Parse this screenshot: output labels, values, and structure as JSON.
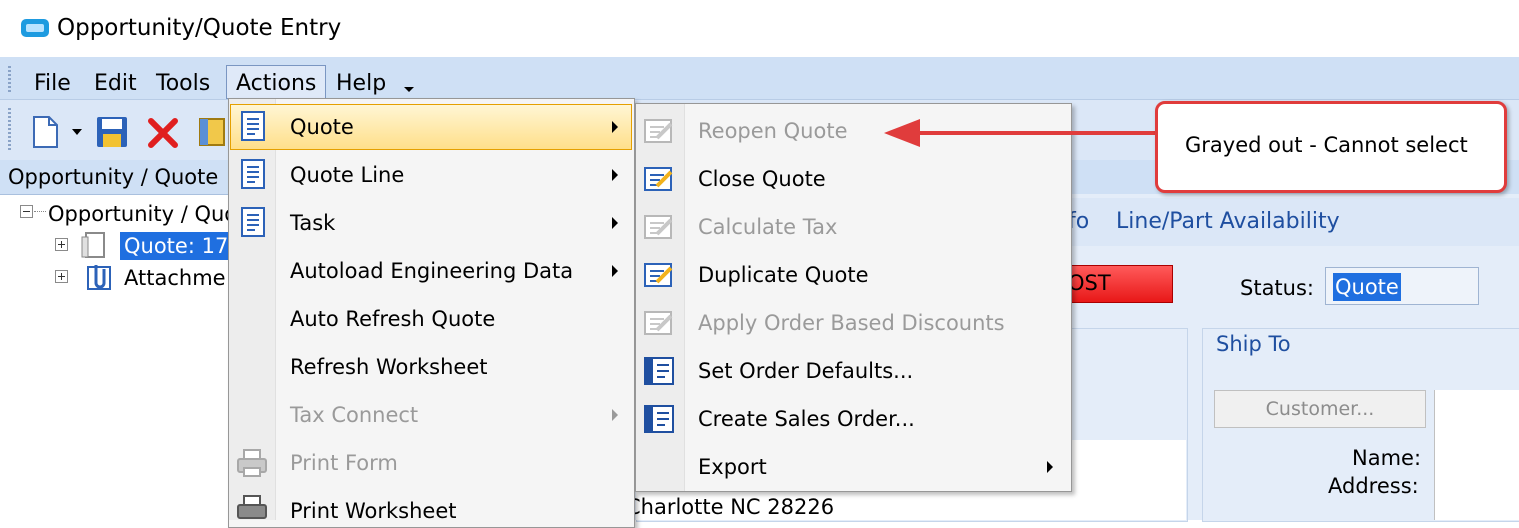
{
  "window": {
    "title": "Opportunity/Quote Entry"
  },
  "menubar": {
    "file": "File",
    "edit": "Edit",
    "tools": "Tools",
    "actions": "Actions",
    "help": "Help"
  },
  "left_panel": {
    "header": "Opportunity / Quote",
    "tree": {
      "root": "Opportunity / Quo",
      "quote_node": "Quote: 17",
      "attachments_node": "Attachme"
    }
  },
  "main": {
    "tab_partial": "fo",
    "tab_availability": "Line/Part Availability",
    "lost_partial": "OST",
    "status_label": "Status:",
    "status_value": "Quote",
    "city": "Charlotte NC 28226",
    "ship_to": {
      "title": "Ship To",
      "customer_button": "Customer...",
      "name_label": "Name:",
      "address_label": "Address:"
    }
  },
  "actions_menu": {
    "items": [
      {
        "label": "Quote",
        "icon": "document-icon",
        "submenu": true,
        "disabled": false,
        "highlighted": true
      },
      {
        "label": "Quote Line",
        "icon": "document-icon",
        "submenu": true,
        "disabled": false
      },
      {
        "label": "Task",
        "icon": "document-icon",
        "submenu": true,
        "disabled": false
      },
      {
        "label": "Autoload Engineering Data",
        "submenu": true,
        "disabled": false
      },
      {
        "label": "Auto Refresh Quote",
        "submenu": false,
        "disabled": false
      },
      {
        "label": "Refresh Worksheet",
        "submenu": false,
        "disabled": false
      },
      {
        "label": "Tax Connect",
        "submenu": true,
        "disabled": true
      },
      {
        "label": "Print Form",
        "icon": "printer-icon",
        "submenu": false,
        "disabled": true
      },
      {
        "label": "Print Worksheet",
        "icon": "printer-icon",
        "submenu": false,
        "disabled": false
      }
    ]
  },
  "quote_submenu": {
    "items": [
      {
        "label": "Reopen Quote",
        "icon": "edit-document-icon",
        "disabled": true
      },
      {
        "label": "Close Quote",
        "icon": "edit-document-icon",
        "disabled": false
      },
      {
        "label": "Calculate Tax",
        "icon": "edit-document-icon",
        "disabled": true
      },
      {
        "label": "Duplicate Quote",
        "icon": "edit-document-icon",
        "disabled": false
      },
      {
        "label": "Apply Order Based Discounts",
        "icon": "edit-document-icon",
        "disabled": true
      },
      {
        "label": "Set Order Defaults...",
        "icon": "order-icon",
        "disabled": false
      },
      {
        "label": "Create Sales Order...",
        "icon": "order-icon",
        "disabled": false
      },
      {
        "label": "Export",
        "submenu": true,
        "disabled": false
      }
    ]
  },
  "callout": {
    "text": "Grayed out - Cannot select",
    "border_color": "#e03c3c"
  },
  "colors": {
    "menubar": "#cfe0f5",
    "highlight": "#ffdf8a",
    "selection": "#1f6fe0",
    "lost": "#e81818",
    "link": "#1f4fa0"
  }
}
